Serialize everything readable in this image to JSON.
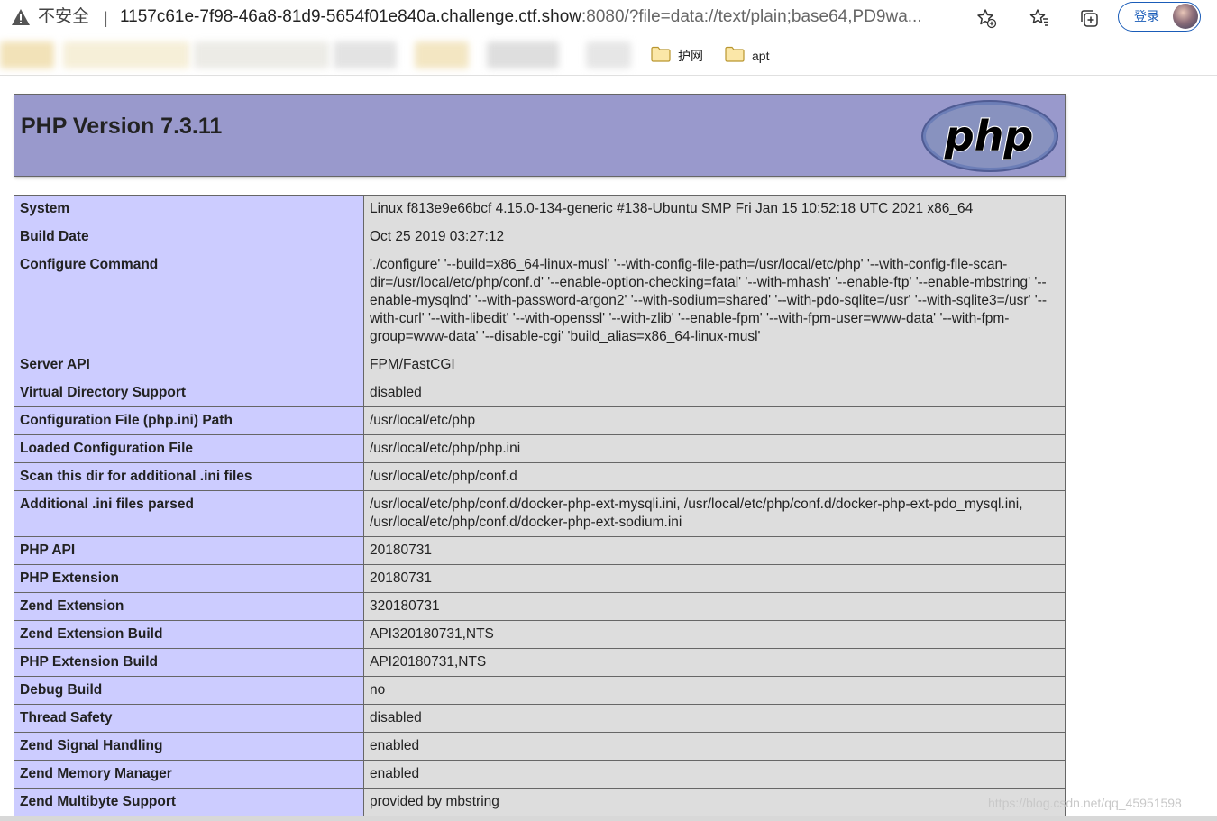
{
  "browser": {
    "security_label": "不安全",
    "separator": "|",
    "url_host": "1157c61e-7f98-46a8-81d9-5654f01e840a.challenge.ctf.show",
    "url_rest": ":8080/?file=data://text/plain;base64,PD9wa...",
    "login_label": "登录",
    "icons": [
      "warning-icon",
      "favorite-add-icon",
      "favorites-icon",
      "collections-icon",
      "avatar"
    ]
  },
  "bookmarks": {
    "items": [
      {
        "label": "护网",
        "icon": "folder-icon"
      },
      {
        "label": "apt",
        "icon": "folder-icon"
      }
    ]
  },
  "phpinfo": {
    "title": "PHP Version 7.3.11",
    "logo_text": "php",
    "rows": [
      {
        "key": "System",
        "value": "Linux f813e9e66bcf 4.15.0-134-generic #138-Ubuntu SMP Fri Jan 15 10:52:18 UTC 2021 x86_64"
      },
      {
        "key": "Build Date",
        "value": "Oct 25 2019 03:27:12"
      },
      {
        "key": "Configure Command",
        "value": "'./configure' '--build=x86_64-linux-musl' '--with-config-file-path=/usr/local/etc/php' '--with-config-file-scan-dir=/usr/local/etc/php/conf.d' '--enable-option-checking=fatal' '--with-mhash' '--enable-ftp' '--enable-mbstring' '--enable-mysqlnd' '--with-password-argon2' '--with-sodium=shared' '--with-pdo-sqlite=/usr' '--with-sqlite3=/usr' '--with-curl' '--with-libedit' '--with-openssl' '--with-zlib' '--enable-fpm' '--with-fpm-user=www-data' '--with-fpm-group=www-data' '--disable-cgi' 'build_alias=x86_64-linux-musl'"
      },
      {
        "key": "Server API",
        "value": "FPM/FastCGI"
      },
      {
        "key": "Virtual Directory Support",
        "value": "disabled"
      },
      {
        "key": "Configuration File (php.ini) Path",
        "value": "/usr/local/etc/php"
      },
      {
        "key": "Loaded Configuration File",
        "value": "/usr/local/etc/php/php.ini"
      },
      {
        "key": "Scan this dir for additional .ini files",
        "value": "/usr/local/etc/php/conf.d"
      },
      {
        "key": "Additional .ini files parsed",
        "value": "/usr/local/etc/php/conf.d/docker-php-ext-mysqli.ini, /usr/local/etc/php/conf.d/docker-php-ext-pdo_mysql.ini, /usr/local/etc/php/conf.d/docker-php-ext-sodium.ini"
      },
      {
        "key": "PHP API",
        "value": "20180731"
      },
      {
        "key": "PHP Extension",
        "value": "20180731"
      },
      {
        "key": "Zend Extension",
        "value": "320180731"
      },
      {
        "key": "Zend Extension Build",
        "value": "API320180731,NTS"
      },
      {
        "key": "PHP Extension Build",
        "value": "API20180731,NTS"
      },
      {
        "key": "Debug Build",
        "value": "no"
      },
      {
        "key": "Thread Safety",
        "value": "disabled"
      },
      {
        "key": "Zend Signal Handling",
        "value": "enabled"
      },
      {
        "key": "Zend Memory Manager",
        "value": "enabled"
      },
      {
        "key": "Zend Multibyte Support",
        "value": "provided by mbstring"
      }
    ]
  },
  "watermark": "https://blog.csdn.net/qq_45951598",
  "colors": {
    "header_bg": "#9999cc",
    "key_cell_bg": "#ccccff",
    "value_cell_bg": "#dddddd",
    "login_accent": "#1a5cb8"
  }
}
